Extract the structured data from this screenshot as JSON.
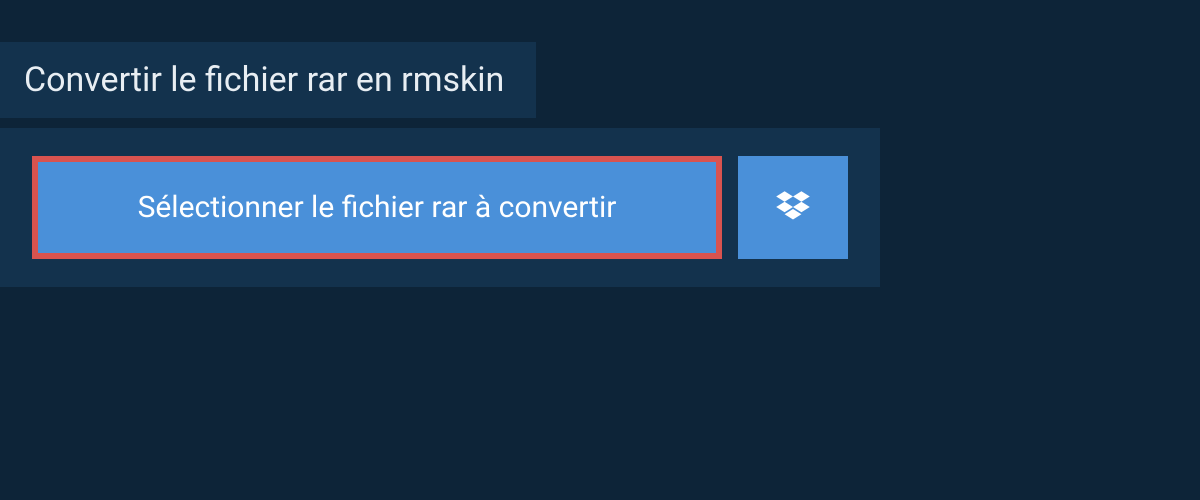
{
  "title": "Convertir le fichier rar en rmskin",
  "buttons": {
    "select_file_label": "Sélectionner le fichier rar à convertir"
  },
  "colors": {
    "background": "#0d2438",
    "panel": "#13324d",
    "button_primary": "#4a90d9",
    "button_highlight_border": "#d9534f",
    "text_light": "#e8eef3",
    "text_white": "#ffffff"
  }
}
